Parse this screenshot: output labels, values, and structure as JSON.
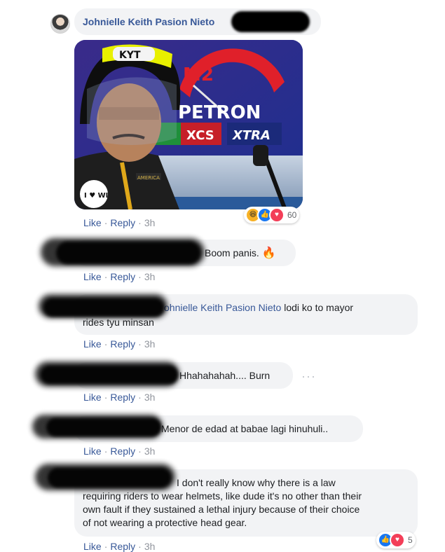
{
  "post": {
    "author_name": "Johnielle Keith Pasion Nieto",
    "reaction_count": "60",
    "photo_texts": {
      "helmet_brand": "KYT",
      "sign_m2": "M2",
      "sign_petron": "PETRON",
      "sign_xcs": "XCS",
      "sign_xtra": "XTRA",
      "badge_love": "I ♥ WI",
      "patch": "AMERICA"
    },
    "actions": {
      "like": "Like",
      "reply": "Reply",
      "sep": "·",
      "time": "3h"
    }
  },
  "comments": [
    {
      "text": "Boom panis.",
      "emoji": "🔥",
      "actions": {
        "like": "Like",
        "reply": "Reply",
        "time": "3h"
      }
    },
    {
      "mention": "ohnielle Keith Pasion Nieto",
      "text_line1": " lodi ko to mayor",
      "text_line2": "rides tyu minsan",
      "actions": {
        "like": "Like",
        "reply": "Reply",
        "time": "3h"
      }
    },
    {
      "text": "Hhahahahah.... Burn",
      "more": "···",
      "actions": {
        "like": "Like",
        "reply": "Reply",
        "time": "3h"
      }
    },
    {
      "text": "Menor de edad at babae lagi hinuhuli..",
      "actions": {
        "like": "Like",
        "reply": "Reply",
        "time": "3h"
      }
    },
    {
      "line1": "I don't really know why there is a law",
      "line2": "requiring riders to wear helmets, like dude it's no other than their",
      "line3": "own fault if they sustained a lethal injury because of their choice",
      "line4": "of not wearing a protective head gear.",
      "reaction_count": "5",
      "actions": {
        "like": "Like",
        "reply": "Reply",
        "time": "3h"
      }
    }
  ],
  "icons": {
    "haha": "haha-reaction-icon",
    "like": "like-reaction-icon",
    "love": "love-reaction-icon",
    "fire": "fire-emoji"
  },
  "colors": {
    "link": "#385898",
    "bubble": "#f2f3f5",
    "meta": "#90949c",
    "like_blue": "#1877f2",
    "love_red": "#f33e58",
    "haha_yellow": "#f7b125"
  }
}
